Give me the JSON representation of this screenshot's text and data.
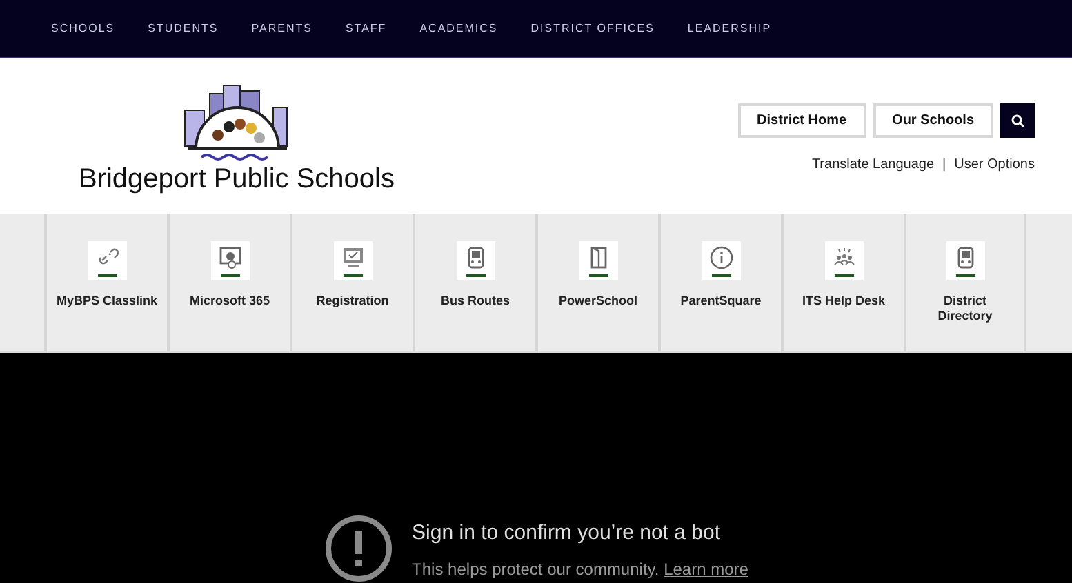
{
  "nav": [
    "SCHOOLS",
    "STUDENTS",
    "PARENTS",
    "STAFF",
    "ACADEMICS",
    "DISTRICT OFFICES",
    "LEADERSHIP"
  ],
  "logo": {
    "name": "Bridgeport Public Schools"
  },
  "header_buttons": [
    "District Home",
    "Our Schools"
  ],
  "utility_links": [
    "Translate Language",
    "|",
    "User Options"
  ],
  "quick_links": [
    {
      "label": "MyBPS Classlink",
      "kind": "link"
    },
    {
      "label": "Microsoft 365",
      "kind": "screen"
    },
    {
      "label": "Registration",
      "kind": "monitor"
    },
    {
      "label": "Bus Routes",
      "kind": "bus"
    },
    {
      "label": "PowerSchool",
      "kind": "door"
    },
    {
      "label": "ParentSquare",
      "kind": "info"
    },
    {
      "label": "ITS Help Desk",
      "kind": "people"
    },
    {
      "label": "District Directory",
      "kind": "bus"
    }
  ],
  "video_notice": {
    "title": "Sign in to confirm you’re not a bot",
    "message": "This helps protect our community.",
    "link": "Learn more"
  }
}
